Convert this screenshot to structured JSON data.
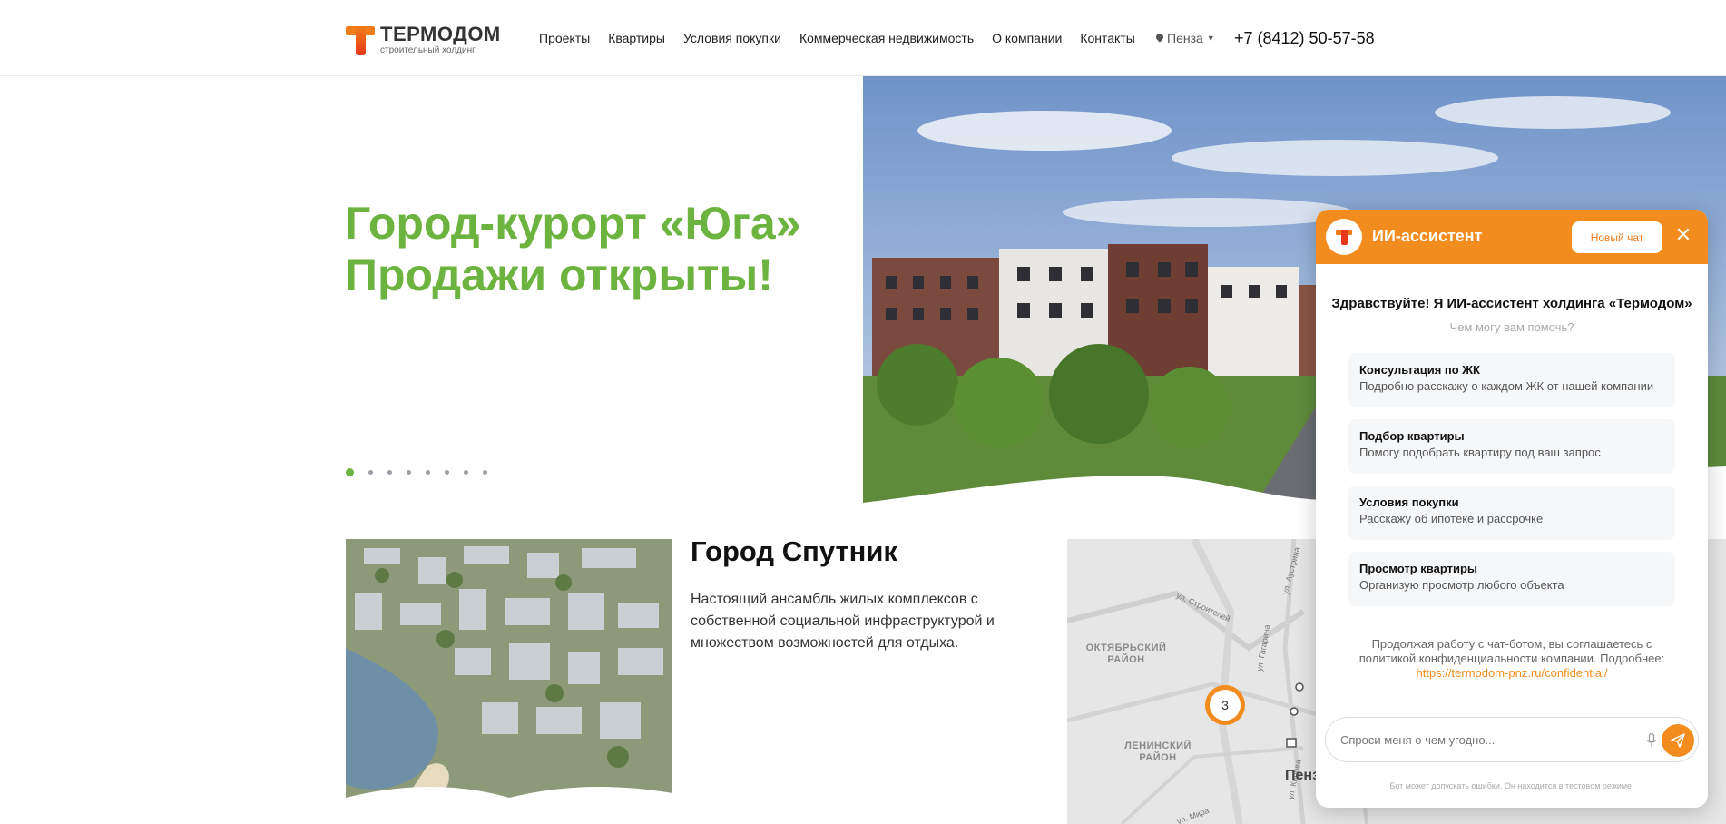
{
  "header": {
    "logo_name": "ТЕРМОДОМ",
    "logo_sub": "строительный холдинг",
    "nav": [
      "Проекты",
      "Квартиры",
      "Условия покупки",
      "Коммерческая недвижимость",
      "О компании",
      "Контакты"
    ],
    "city": "Пенза",
    "phone": "+7 (8412) 50-57-58"
  },
  "hero": {
    "title_line1": "Город-курорт «Юга»",
    "title_line2": "Продажи открыты!",
    "slides_count": 8,
    "active_slide": 1,
    "accent_color": "#6db33f"
  },
  "sputnik": {
    "title": "Город Спутник",
    "description": "Настоящий ансамбль жилых комплексов с собственной социальной инфраструктурой и множеством возможностей для отдыха."
  },
  "map": {
    "districts": [
      "ОКТЯБРЬСКИЙ РАЙОН",
      "ЛЕНИНСКИЙ РАЙОН"
    ],
    "streets": [
      "ул. Строителей",
      "ул. Аустрина",
      "ул. Гагарина",
      "ул. Кирова",
      "ул. Мира"
    ],
    "city_label": "Пенз",
    "cluster_count": "3"
  },
  "chat": {
    "title": "ИИ-ассистент",
    "new_chat_label": "Новый чат",
    "greeting": "Здравствуйте! Я ИИ-ассистент холдинга «Термодом»",
    "greeting_sub": "Чем могу вам помочь?",
    "options": [
      {
        "title": "Консультация по ЖК",
        "desc": "Подробно расскажу о каждом ЖК от нашей компании"
      },
      {
        "title": "Подбор квартиры",
        "desc": "Помогу подобрать квартиру под ваш запрос"
      },
      {
        "title": "Условия покупки",
        "desc": "Расскажу об ипотеке и рассрочке"
      },
      {
        "title": "Просмотр квартиры",
        "desc": "Организую просмотр любого объекта"
      }
    ],
    "consent_text": "Продолжая работу с чат-ботом, вы соглашаетесь с политикой конфиденциальности компании. Подробнее:",
    "consent_link": "https://termodom-pnz.ru/confidential/",
    "input_placeholder": "Спроси меня о чем угодно...",
    "disclaimer": "Бот может допускать ошибки. Он находится в тестовом режиме.",
    "accent_color": "#f28c1e"
  }
}
